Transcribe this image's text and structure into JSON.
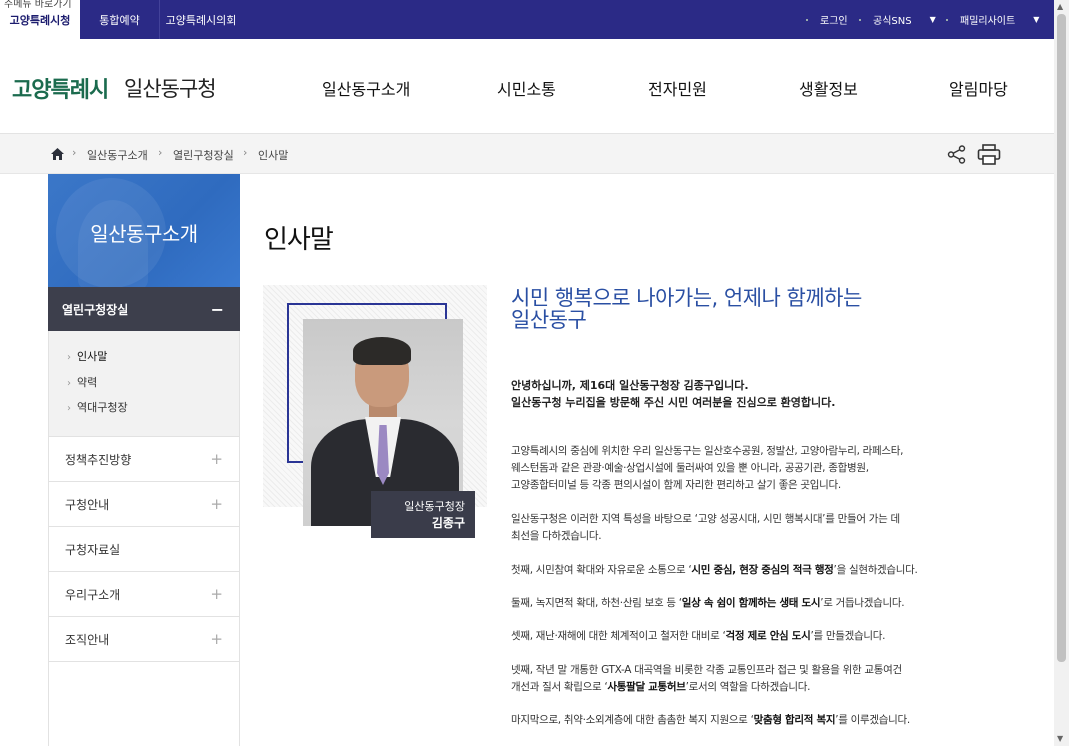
{
  "topbar": {
    "skip_link": "주메뉴 바로가기",
    "tabs": [
      {
        "label": "고양특례시청"
      },
      {
        "label": "통합예약"
      },
      {
        "label": "고양특례시의회"
      }
    ],
    "util": {
      "login": "로그인",
      "sns": "공식SNS",
      "family": "패밀리사이트"
    }
  },
  "header": {
    "logo_main": "고양특례시",
    "logo_sub": "일산동구청",
    "gnb": [
      "일산동구소개",
      "시민소통",
      "전자민원",
      "생활정보",
      "알림마당"
    ]
  },
  "breadcrumb": [
    "일산동구소개",
    "열린구청장실",
    "인사말"
  ],
  "sidebar": {
    "title": "일산동구소개",
    "active_menu": "열린구청장실",
    "sub_items": [
      "인사말",
      "약력",
      "역대구청장"
    ],
    "menus": [
      {
        "label": "정책추진방향",
        "expandable": true
      },
      {
        "label": "구청안내",
        "expandable": true
      },
      {
        "label": "구청자료실",
        "expandable": false
      },
      {
        "label": "우리구소개",
        "expandable": true
      },
      {
        "label": "조직안내",
        "expandable": true
      }
    ]
  },
  "content": {
    "page_title": "인사말",
    "caption_role": "일산동구청장",
    "caption_name": "김종구",
    "headline_line1": "시민 행복으로 나아가는, 언제나 함께하는",
    "headline_line2": "일산동구",
    "greet_line1": "안녕하십니까, 제16대 일산동구청장 김종구입니다.",
    "greet_line2": "일산동구청 누리집을 방문해 주신 시민 여러분을 진심으로 환영합니다.",
    "p1_l1": "고양특례시의 중심에 위치한 우리 일산동구는 일산호수공원, 정발산, 고양아람누리, 라페스타,",
    "p1_l2": "웨스턴돔과 같은 관광·예술·상업시설에 둘러싸여 있을 뿐 아니라, 공공기관, 종합병원,",
    "p1_l3": "고양종합터미널 등 각종 편의시설이 함께 자리한 편리하고 살기 좋은 곳입니다.",
    "p2_l1": "일산동구청은 이러한 지역 특성을 바탕으로 ‘고양 성공시대, 시민 행복시대’를 만들어 가는 데",
    "p2_l2": "최선을 다하겠습니다.",
    "p3_pre": "첫째, 시민참여 확대와 자유로운 소통으로 ‘",
    "p3_bold": "시민 중심, 현장 중심의 적극 행정",
    "p3_post": "’을 실현하겠습니다.",
    "p4_pre": "둘째, 녹지면적 확대, 하천·산림 보호 등 ‘",
    "p4_bold": "일상 속 쉼이 함께하는 생태 도시",
    "p4_post": "’로 거듭나겠습니다.",
    "p5_pre": "셋째, 재난·재해에 대한 체계적이고 철저한 대비로 ‘",
    "p5_bold": "걱정 제로 안심 도시",
    "p5_post": "’를 만들겠습니다.",
    "p6_l1": "넷째, 작년 말 개통한 GTX-A 대곡역을 비롯한 각종 교통인프라 접근 및 활용을 위한 교통여건",
    "p6_pre": "개선과 질서 확립으로 ‘",
    "p6_bold": "사통팔달 교통허브",
    "p6_post": "’로서의 역할을 다하겠습니다.",
    "p7_pre": "마지막으로, 취약·소외계층에 대한 촘촘한 복지 지원으로 ‘",
    "p7_bold": "맞춤형 합리적 복지",
    "p7_post": "’를 이루겠습니다."
  },
  "icons": {
    "home": "home-icon",
    "share": "share-icon",
    "print": "print-icon"
  },
  "colors": {
    "topbar": "#2b2a86",
    "logo_green": "#1b6b4e",
    "headline_blue": "#2a4fa3",
    "sidebar_blue": "#3274c6",
    "sidebar_active": "#3d3f4c"
  }
}
